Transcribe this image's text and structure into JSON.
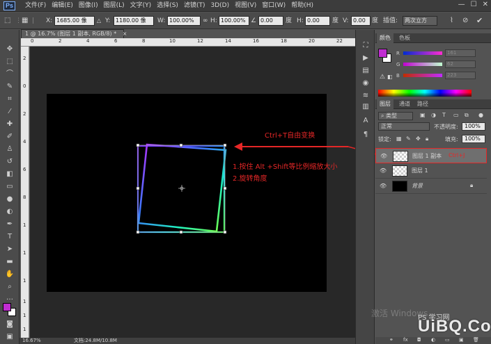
{
  "app": {
    "logo": "Ps"
  },
  "menubar": {
    "items": [
      "文件(F)",
      "编辑(E)",
      "图像(I)",
      "图层(L)",
      "文字(Y)",
      "选择(S)",
      "滤镜(T)",
      "3D(D)",
      "视图(V)",
      "窗口(W)",
      "帮助(H)"
    ],
    "window_buttons": [
      "—",
      "☐",
      "✕"
    ]
  },
  "options": {
    "x_label": "X:",
    "x_value": "1685.00 像",
    "y_label": "Y:",
    "y_value": "1180.00 像",
    "w_label": "W:",
    "w_value": "100.00%",
    "h_label": "H:",
    "h_value": "100.00%",
    "angle_value": "0.00",
    "angle_unit": "度",
    "hskew_label": "H:",
    "hskew_value": "0.00",
    "hskew_unit": "度",
    "vskew_label": "V:",
    "vskew_value": "0.00",
    "vskew_unit": "度",
    "interp_label": "插值:",
    "interp_value": "两次立方"
  },
  "document": {
    "tab_title": "1 @ 16.7% (图层 1 副本, RGB/8) *",
    "close": "×"
  },
  "ruler": {
    "top": [
      "0",
      "2",
      "4",
      "6",
      "8",
      "10",
      "12",
      "14",
      "16",
      "18",
      "20",
      "22"
    ],
    "left": [
      "2",
      "0",
      "2",
      "4",
      "6",
      "8",
      "1",
      "1",
      "1",
      "1",
      "1",
      "1"
    ]
  },
  "annotations": {
    "free_transform": "Ctrl+T自由变换",
    "step1": "1.按住 Alt +Shift等比例缩放大小",
    "step2": "2.旋转角度"
  },
  "colors": {
    "accent": "#e52727",
    "foreground": "#c02cd1",
    "background": "#ffffff",
    "canvas": "#000000"
  },
  "color_panel": {
    "tabs": [
      "颜色",
      "色板"
    ],
    "r_label": "R",
    "r_value": "161",
    "g_label": "G",
    "g_value": "62",
    "b_label": "B",
    "b_value": "223"
  },
  "layers_panel": {
    "tabs": [
      "图层",
      "通道",
      "路径"
    ],
    "filter_kind": "类型",
    "blend_mode": "正常",
    "opacity_label": "不透明度:",
    "opacity_value": "100%",
    "lock_label": "锁定:",
    "fill_label": "填充:",
    "fill_value": "100%",
    "layers": [
      {
        "name": "图层 1 副本",
        "highlight": "Ctrl+J"
      },
      {
        "name": "图层 1"
      },
      {
        "name": "背景"
      }
    ]
  },
  "status": {
    "zoom": "16.67%",
    "doc": "文档:24.8M/10.8M"
  },
  "watermark": {
    "text": "激活 Windows",
    "logo": "UiBQ.CoM",
    "sub": "PS 学习网"
  }
}
